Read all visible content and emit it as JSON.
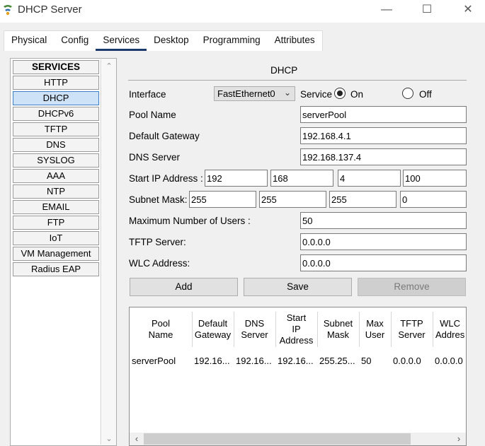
{
  "window": {
    "title": "DHCP Server",
    "controls": {
      "minimize": "—",
      "maximize": "☐",
      "close": "✕"
    }
  },
  "tabs": [
    {
      "label": "Physical"
    },
    {
      "label": "Config"
    },
    {
      "label": "Services",
      "active": true
    },
    {
      "label": "Desktop"
    },
    {
      "label": "Programming"
    },
    {
      "label": "Attributes"
    }
  ],
  "services_menu": {
    "header": "SERVICES",
    "items": [
      "HTTP",
      "DHCP",
      "DHCPv6",
      "TFTP",
      "DNS",
      "SYSLOG",
      "AAA",
      "NTP",
      "EMAIL",
      "FTP",
      "IoT",
      "VM Management",
      "Radius EAP"
    ],
    "selected": "DHCP"
  },
  "dhcp": {
    "title": "DHCP",
    "interface_label": "Interface",
    "interface_value": "FastEthernet0",
    "service_label": "Service",
    "on_label": "On",
    "off_label": "Off",
    "service_on": true,
    "pool_name_label": "Pool Name",
    "pool_name": "serverPool",
    "gateway_label": "Default Gateway",
    "gateway": "192.168.4.1",
    "dns_label": "DNS Server",
    "dns": "192.168.137.4",
    "start_ip_label": "Start IP Address :",
    "start_ip": [
      "192",
      "168",
      "4",
      "100"
    ],
    "subnet_label": "Subnet Mask:",
    "subnet": [
      "255",
      "255",
      "255",
      "0"
    ],
    "max_users_label": "Maximum Number of Users :",
    "max_users": "50",
    "tftp_label": "TFTP Server:",
    "tftp": "0.0.0.0",
    "wlc_label": "WLC Address:",
    "wlc": "0.0.0.0",
    "add_label": "Add",
    "save_label": "Save",
    "remove_label": "Remove"
  },
  "pool_table": {
    "headers": [
      "Pool\nName",
      "Default\nGateway",
      "DNS\nServer",
      "Start\nIP\nAddress",
      "Subnet\nMask",
      "Max\nUser",
      "TFTP\nServer",
      "WLC\nAddres"
    ],
    "row": [
      "serverPool",
      "192.16...",
      "192.16...",
      "192.16...",
      "255.25...",
      "50",
      "0.0.0.0",
      "0.0.0.0"
    ]
  }
}
